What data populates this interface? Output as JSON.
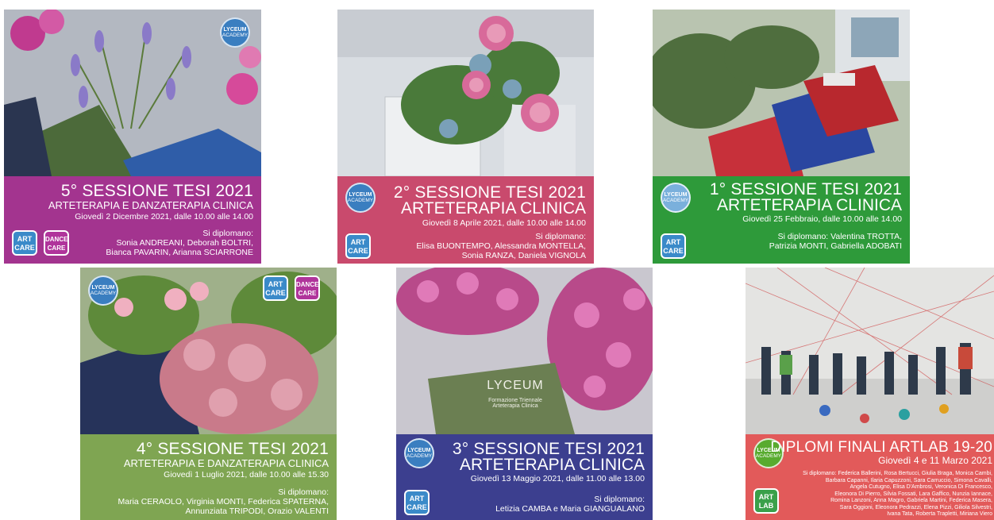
{
  "cards": [
    {
      "session": "5° SESSIONE TESI 2021",
      "subtitle": "ARTETERAPIA E DANZATERAPIA CLINICA",
      "date": "Giovedì 2 Dicembre 2021, dalle 10.00 alle 14.00",
      "grad_lines": [
        "Si diplomano:",
        "Sonia ANDREANI, Deborah BOLTRI,",
        "Bianca PAVARIN, Arianna SCIARRONE"
      ],
      "band_color": "#a3348f",
      "badges": [
        "ART CARE",
        "DANCE CARE"
      ]
    },
    {
      "session": "2° SESSIONE TESI 2021",
      "subtitle": "ARTETERAPIA CLINICA",
      "date": "Giovedì 8 Aprile 2021, dalle 10.00 alle 14.00",
      "grad_lines": [
        "Si diplomano:",
        "Elisa BUONTEMPO, Alessandra MONTELLA,",
        "Sonia RANZA, Daniela VIGNOLA"
      ],
      "band_color": "#c94a6d",
      "badges": [
        "ART CARE"
      ]
    },
    {
      "session": "1° SESSIONE TESI 2021",
      "subtitle": "ARTETERAPIA CLINICA",
      "date": "Giovedì 25 Febbraio, dalle 10.00 alle 14.00",
      "grad_lines": [
        "Si diplomano: Valentina TROTTA,",
        "Patrizia MONTI, Gabriella ADOBATI"
      ],
      "band_color": "#2e9a3a",
      "badges": [
        "ART CARE"
      ]
    },
    {
      "session": "4° SESSIONE TESI 2021",
      "subtitle": "ARTETERAPIA E DANZATERAPIA CLINICA",
      "date": "Giovedì 1 Luglio 2021, dalle 10.00 alle 15.30",
      "grad_lines": [
        "Si diplomano:",
        "Maria CERAOLO, Virginia MONTI, Federica SPATERNA,",
        "Annunziata TRIPODI, Orazio VALENTI"
      ],
      "band_color": "#7fa552",
      "badges": [
        "ART CARE",
        "DANCE CARE"
      ]
    },
    {
      "session": "3° SESSIONE TESI 2021",
      "subtitle": "ARTETERAPIA CLINICA",
      "date": "Giovedì 13 Maggio 2021, dalle 11.00 alle 13.00",
      "grad_lines": [
        "Si diplomano:",
        "Letizia CAMBA e Maria GIANGUALANO"
      ],
      "band_color": "#3c3f8f",
      "badges": [
        "ART CARE"
      ]
    },
    {
      "session": "DIPLOMI FINALI ARTLAB 19-20",
      "subtitle": "",
      "date": "Giovedì 4 e 11 Marzo 2021",
      "grad_lines": [
        "Si diplomano: Federica Ballerini, Rosa Bertucci, Giulia Braga, Monica Cambi,",
        "Barbara Capanni, Ilaria Capuzzoni, Sara Carruccio, Simona Cavalli,",
        "Angela Cutugno, Elisa D'Ambrosi, Veronica Di Francesco,",
        "Eleonora Di Pierro, Silvia Fossati, Lara Gaffico, Nunzia Iannace,",
        "Romina Lanzoni, Anna Magro, Gabriela Martini, Federica Masera,",
        "Sara Oggioni, Eleonora Pedrazzi, Elena Pizzi, Giliola Silvestri,",
        "Ivana Tata, Roberta Trapletti, Miriana Viero"
      ],
      "band_color": "#e25a5a",
      "badges": [
        "ART LAB"
      ]
    }
  ],
  "logo": {
    "line1": "LYCEUM",
    "line2": "ACADEMY"
  },
  "badge_labels": {
    "art_care": [
      "ART",
      "CARE"
    ],
    "dance_care": [
      "DANCE",
      "CARE"
    ],
    "art_lab": [
      "ART",
      "LAB"
    ]
  },
  "book_text": {
    "lyceum": "LYCEUM",
    "line1": "Formazione Triennale",
    "line2": "Arteterapia Clinica"
  }
}
